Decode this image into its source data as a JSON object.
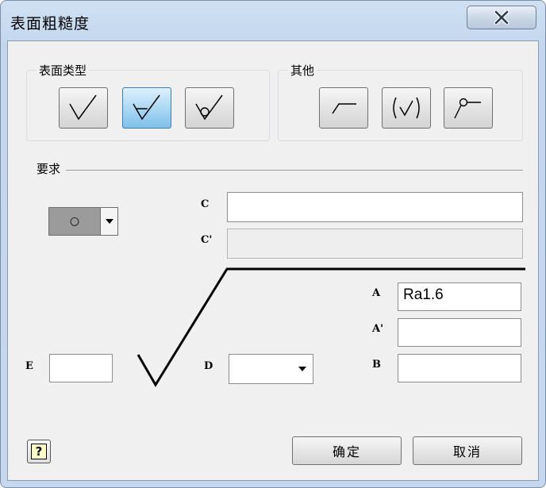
{
  "window": {
    "title": "表面粗糙度"
  },
  "surface_type": {
    "title": "表面类型",
    "buttons": [
      {
        "icon": "basic-check-icon",
        "active": false
      },
      {
        "icon": "material-removal-icon",
        "active": true
      },
      {
        "icon": "no-removal-icon",
        "active": false
      }
    ]
  },
  "other": {
    "title": "其他",
    "buttons": [
      {
        "icon": "long-leg-icon"
      },
      {
        "icon": "parenthesis-check-icon"
      },
      {
        "icon": "leader-circle-icon"
      }
    ]
  },
  "requirements": {
    "title": "要求",
    "lay_symbol": {
      "value": "○"
    },
    "labels": {
      "c": "C",
      "c_prime": "C'",
      "a": "A",
      "a_prime": "A'",
      "b": "B",
      "d": "D",
      "e": "E"
    },
    "fields": {
      "c": "",
      "c_prime": "",
      "a": "Ra1.6",
      "a_prime": "",
      "b": "",
      "d": "",
      "e": ""
    }
  },
  "footer": {
    "help_label": "?",
    "ok_label": "确定",
    "cancel_label": "取消"
  }
}
